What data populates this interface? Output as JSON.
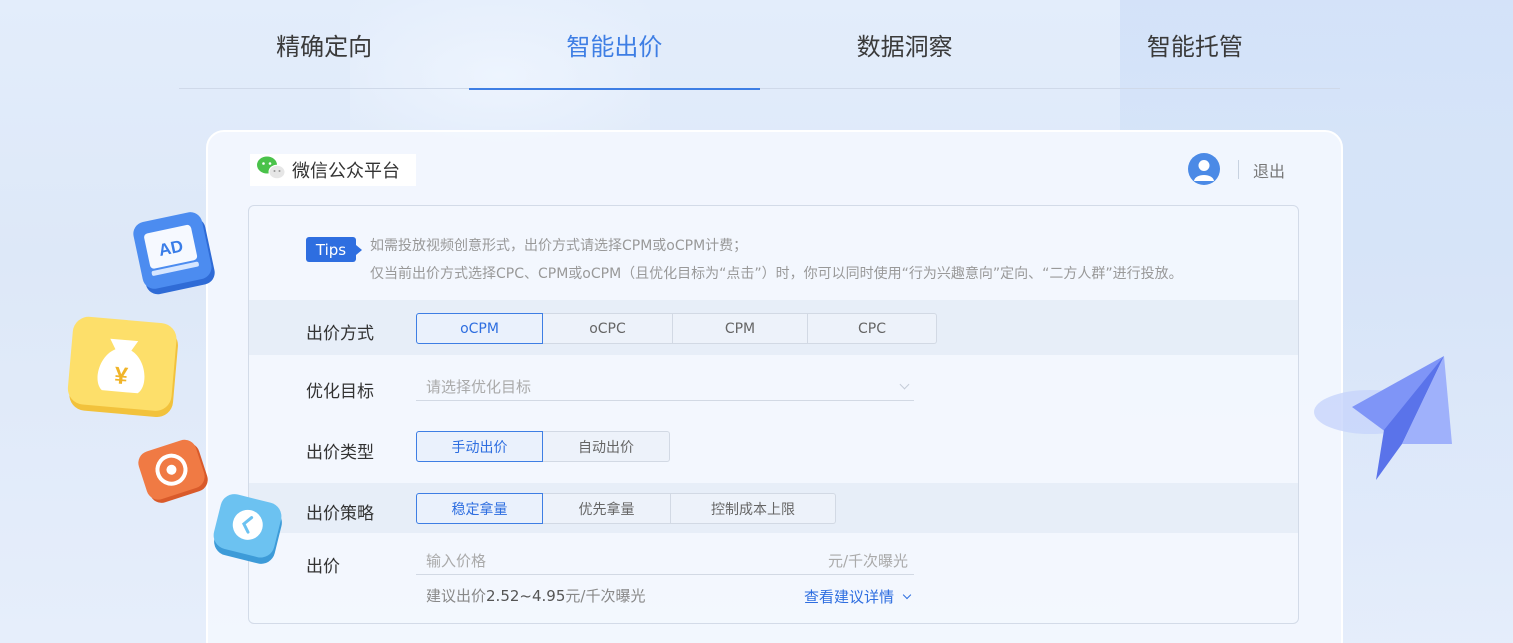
{
  "nav": {
    "tabs": [
      {
        "label": "精确定向",
        "active": false
      },
      {
        "label": "智能出价",
        "active": true
      },
      {
        "label": "数据洞察",
        "active": false
      },
      {
        "label": "智能托管",
        "active": false
      }
    ]
  },
  "header": {
    "brand_name": "微信公众平台",
    "logout_label": "退出"
  },
  "tips": {
    "badge": "Tips",
    "line1": "如需投放视频创意形式，出价方式请选择CPM或oCPM计费；",
    "line2": "仅当前出价方式选择CPC、CPM或oCPM（且优化目标为“点击”）时，你可以同时使用“行为兴趣意向”定向、“二方人群”进行投放。"
  },
  "bid_method": {
    "label": "出价方式",
    "options": [
      "oCPM",
      "oCPC",
      "CPM",
      "CPC"
    ],
    "selected": "oCPM"
  },
  "goal": {
    "label": "优化目标",
    "placeholder": "请选择优化目标"
  },
  "bid_type": {
    "label": "出价类型",
    "options": [
      "手动出价",
      "自动出价"
    ],
    "selected": "手动出价"
  },
  "strategy": {
    "label": "出价策略",
    "options": [
      "稳定拿量",
      "优先拿量",
      "控制成本上限"
    ],
    "selected": "稳定拿量"
  },
  "price": {
    "label": "出价",
    "placeholder": "输入价格",
    "unit": "元/千次曝光",
    "hint_prefix": "建议出价",
    "hint_range": "2.52~4.95",
    "hint_unit": "元/千次曝光",
    "detail_link": "查看建议详情"
  },
  "decor": {
    "ad_icon_text": "AD",
    "yen_icon_text": "¥"
  },
  "colors": {
    "accent": "#3e7ee4",
    "badge": "#2e6ee0"
  }
}
